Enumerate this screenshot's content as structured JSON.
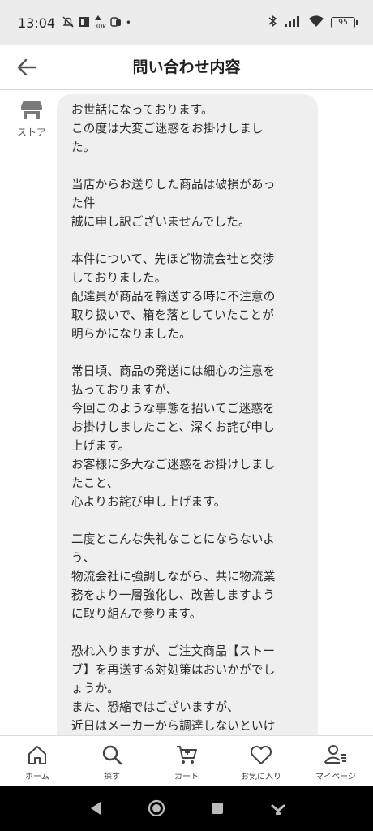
{
  "status_bar": {
    "time": "13:04",
    "battery": "95",
    "small_label": "30k"
  },
  "header": {
    "title": "問い合わせ内容"
  },
  "sender": {
    "label": "ストア"
  },
  "message_lines": [
    "お世話になっております。",
    "この度は大変ご迷惑をお掛けしまし",
    "た。",
    "",
    "当店からお送りした商品は破損があっ",
    "た件",
    "誠に申し訳ございませんでした。",
    "",
    "本件について、先ほど物流会社と交渉",
    "しておりました。",
    "配達員が商品を輸送する時に不注意の",
    "取り扱いで、箱を落としていたことが",
    "明らかになりました。",
    "",
    "常日頃、商品の発送には細心の注意を",
    "払っておりますが、",
    "今回このような事態を招いてご迷惑を",
    "お掛けしましたこと、深くお詫び申し",
    "上げます。",
    "お客様に多大なご迷惑をお掛けしまし",
    "たこと、",
    "心よりお詫び申し上げます。",
    "",
    "二度とこんな失礼なことにならないよ",
    "う、",
    "物流会社に強調しながら、共に物流業",
    "務をより一層強化し、改善しますよう",
    "に取り組んで参ります。",
    "",
    "恐れ入りますが、ご注文商品【ストー",
    "ブ】を再送する対処策はおいかがでし",
    "ょうか。",
    "また、恐縮ではございますが、",
    "近日はメーカーから調達しないといけ"
  ],
  "bottom_nav": [
    {
      "label": "ホーム",
      "icon": "home-icon"
    },
    {
      "label": "探す",
      "icon": "search-icon"
    },
    {
      "label": "カート",
      "icon": "cart-icon"
    },
    {
      "label": "お気に入り",
      "icon": "heart-icon"
    },
    {
      "label": "マイページ",
      "icon": "user-icon"
    }
  ]
}
